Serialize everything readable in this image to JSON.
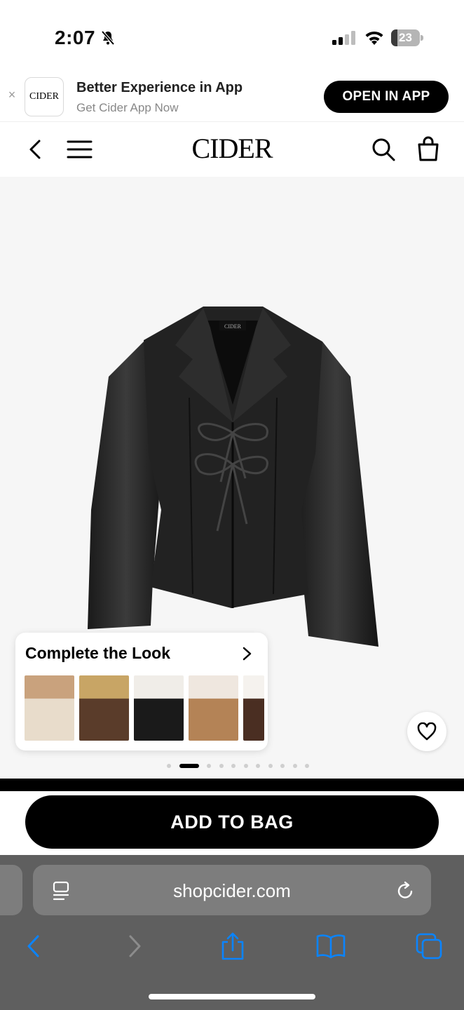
{
  "status_bar": {
    "time": "2:07",
    "battery": "23",
    "battery_level": 0.23,
    "icons": [
      "bell-slash-icon",
      "cellular-signal-icon",
      "wifi-icon",
      "battery-icon"
    ]
  },
  "app_banner": {
    "logo_text": "CIDER",
    "title": "Better Experience in App",
    "subtitle": "Get Cider App Now",
    "open_button": "OPEN IN APP",
    "close_symbol": "×"
  },
  "header": {
    "logo": "CIDER",
    "icons": [
      "back-chevron-icon",
      "hamburger-menu-icon",
      "search-icon",
      "shopping-bag-icon"
    ]
  },
  "product": {
    "jacket_label": "CIDER",
    "image_count": 11,
    "active_image_index": 1
  },
  "complete_the_look": {
    "title": "Complete the Look",
    "items": [
      {
        "name": "beige-snow-boots",
        "colors": [
          "#e8dccb",
          "#c9a27d"
        ]
      },
      {
        "name": "brown-fur-boots",
        "colors": [
          "#5a3c2a",
          "#c8a565"
        ]
      },
      {
        "name": "black-knee-boots",
        "colors": [
          "#1a1a1a",
          "#f0ede8"
        ]
      },
      {
        "name": "tan-tall-boots",
        "colors": [
          "#b48356",
          "#efe7df"
        ]
      },
      {
        "name": "brown-loafer",
        "colors": [
          "#4a2e22",
          "#f5f2ee"
        ]
      }
    ]
  },
  "actions": {
    "add_to_bag": "ADD TO BAG",
    "wishlist_icon": "heart-icon"
  },
  "browser": {
    "url": "shopcider.com",
    "accent_color": "#0a84ff",
    "toolbar": [
      "back-icon",
      "forward-icon",
      "share-icon",
      "bookmarks-icon",
      "tabs-icon"
    ]
  }
}
